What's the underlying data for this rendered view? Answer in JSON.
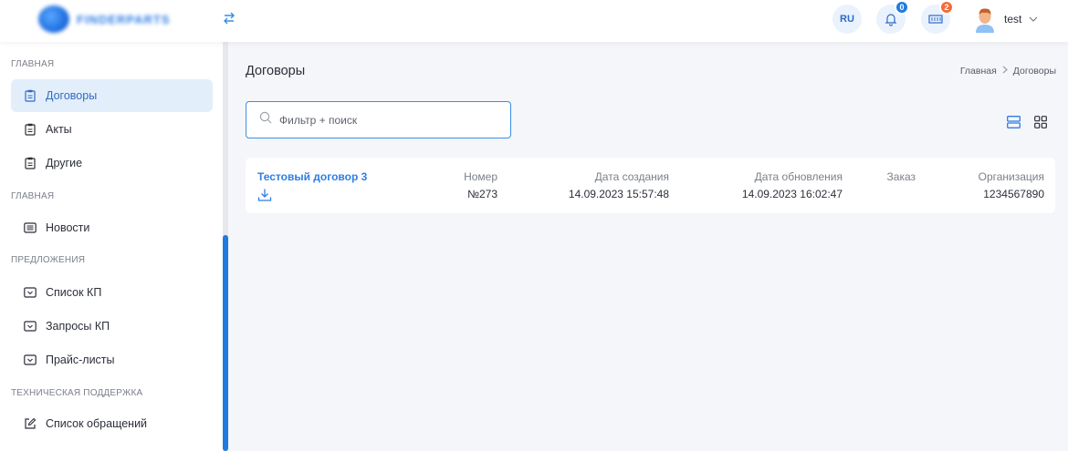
{
  "header": {
    "logo_text": "FINDERPARTS",
    "lang": "RU",
    "notifications_count": "0",
    "cart_count": "2",
    "username": "test",
    "colors": {
      "accent": "#2f7de6",
      "badge_blue": "#1f7be0",
      "badge_orange": "#f26b3a"
    }
  },
  "sidebar": {
    "sections": [
      "ГЛАВНАЯ",
      "ГЛАВНАЯ",
      "ПРЕДЛОЖЕНИЯ",
      "ТЕХНИЧЕСКАЯ ПОДДЕРЖКА"
    ],
    "items": [
      {
        "label": "Договоры",
        "icon": "clipboard-icon",
        "active": true
      },
      {
        "label": "Акты",
        "icon": "clipboard-icon"
      },
      {
        "label": "Другие",
        "icon": "clipboard-icon"
      },
      {
        "label": "Новости",
        "icon": "news-icon"
      },
      {
        "label": "Список КП",
        "icon": "inbox-icon"
      },
      {
        "label": "Запросы КП",
        "icon": "inbox-icon"
      },
      {
        "label": "Прайс-листы",
        "icon": "inbox-icon"
      },
      {
        "label": "Список обращений",
        "icon": "edit-icon"
      }
    ]
  },
  "main": {
    "title": "Договоры",
    "breadcrumb": [
      "Главная",
      "Договоры"
    ],
    "search_placeholder": "Фильтр + поиск",
    "contract": {
      "name": "Тестовый договор 3",
      "columns": [
        {
          "label": "Номер",
          "value": "№273"
        },
        {
          "label": "Дата создания",
          "value": "14.09.2023 15:57:48"
        },
        {
          "label": "Дата обновления",
          "value": "14.09.2023 16:02:47"
        },
        {
          "label": "Заказ",
          "value": ""
        },
        {
          "label": "Организация",
          "value": "1234567890"
        }
      ]
    }
  }
}
